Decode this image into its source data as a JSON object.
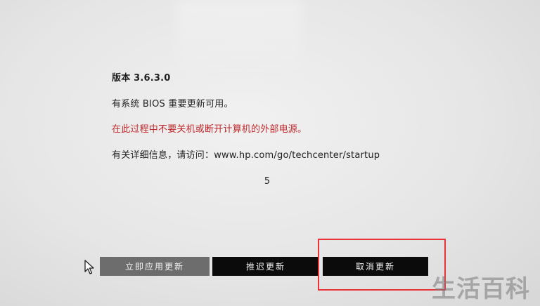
{
  "bios_update": {
    "version_line": "版本 3.6.3.0",
    "available_line": "有系统 BIOS 重要更新可用。",
    "warning_line": "在此过程中不要关机或断开计算机的外部电源。",
    "info_line": "有关详细信息，请访问：www.hp.com/go/techcenter/startup",
    "countdown": "5"
  },
  "buttons": {
    "apply_label": "立即应用更新",
    "postpone_label": "推迟更新",
    "cancel_label": "取消更新"
  },
  "watermark": "生活百科",
  "colors": {
    "warning_text": "#c0292b",
    "highlight_box": "#e8333a",
    "selected_button": "#6d6d6d",
    "button": "#0b0b0b"
  },
  "icons": {
    "cursor": "mouse-pointer-icon"
  }
}
